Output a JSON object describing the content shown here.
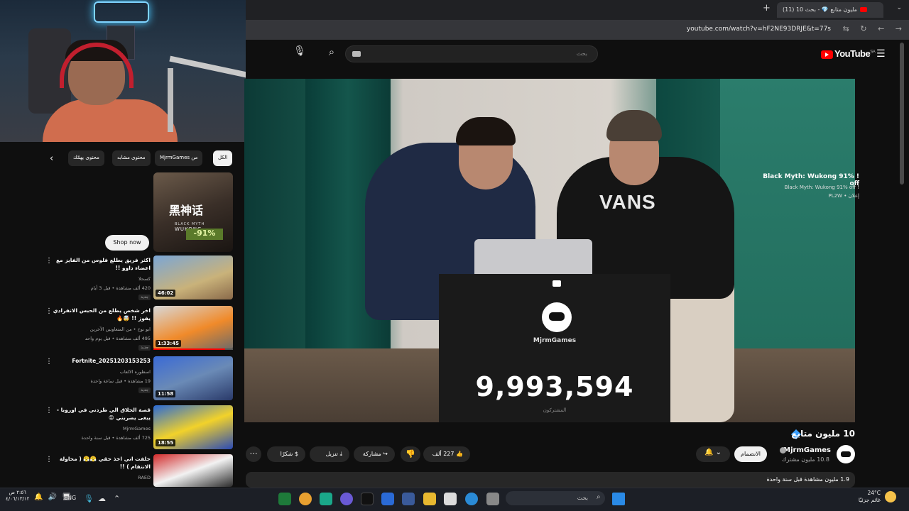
{
  "browser": {
    "tab_title": "(11) 10 مليون متابع 💎 - بحث",
    "url": "youtube.com/watch?v=hF2NE93DRJE&t=77s"
  },
  "youtube": {
    "search_placeholder": "بحث",
    "logo": "YouTube",
    "region": "SA"
  },
  "counter": {
    "channel": "MjrmGames",
    "value": "9,993,594",
    "label": "المشتركون"
  },
  "video": {
    "title": "10 مليون متابع",
    "channel_name": "MjrmGames",
    "subscribers": "10.8 مليون مشترك",
    "join_label": "الانضمام",
    "like_count": "227 ألف",
    "share_label": "مشاركة",
    "download_label": "تنزيل",
    "thanks_label": "شكرًا",
    "views_line": "1.9 مليون مشاهدة قبل سنة واحدة"
  },
  "sidebar": {
    "chips": [
      "الكل",
      "من MjrmGames",
      "محتوى مشابه",
      "محتوى يهمّك"
    ],
    "ad": {
      "title": "! Black Myth: Wukong 91% off",
      "subtitle": "! Black Myth: Wukong 91% off",
      "sponsor": "إعلان • PL2W",
      "thumb_logo": "黑神话",
      "thumb_sub": "BLACK MYTH",
      "thumb_sub2": "WUKONG",
      "discount": "-91%",
      "shop_label": "Shop now"
    },
    "recommendations": [
      {
        "title": "اكثر فريق يطلع فلوس من الفايز مع اعضاء داوو !!",
        "channel": "كسحلا",
        "meta": "420 ألف مشاهدة • قبل 3 أيام",
        "badge": "جديد",
        "duration": "46:02"
      },
      {
        "title": "اخر شخص يطلع من الحبس الانفرادي يفوز !! 🤯🔥",
        "channel": "ابو نوح • من المتعاونين الآخرين",
        "meta": "495 ألف مشاهدة • قبل يوم واحد",
        "badge": "جديد",
        "duration": "1:33:45"
      },
      {
        "title": "Fortnite_20251203153253",
        "channel": "اسطوره الالعاب",
        "meta": "19 مشاهدة • قبل ساعة واحدة",
        "badge": "جديد",
        "duration": "11:58"
      },
      {
        "title": "قصة الحلاق الي طردني في اوروبا - يبغى يضربني 😡",
        "channel": "MjrmGames",
        "meta": "725 ألف مشاهدة • قبل سنة واحدة",
        "badge": "",
        "duration": "18:55"
      },
      {
        "title": "حلفت اني اخذ حقي 😤😤 ( محاولة الانتقام ) !!",
        "channel": "RAED",
        "meta": "",
        "badge": "",
        "duration": ""
      }
    ]
  },
  "taskbar": {
    "search_placeholder": "بحث",
    "weather_temp": "24°C",
    "weather_desc": "غائم جزئيًا",
    "language": "ENG",
    "time": "٢:٥٦ ص",
    "date": "٤/٠٦/١٣/١٢"
  }
}
